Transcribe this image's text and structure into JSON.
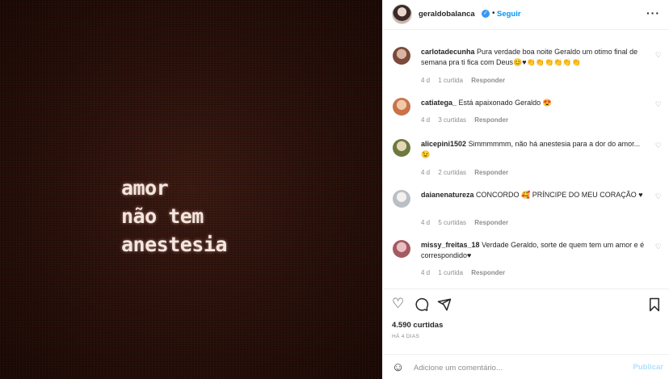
{
  "media": {
    "lines": [
      "amor",
      "não tem",
      "anestesia"
    ]
  },
  "header": {
    "username": "geraldobalanca",
    "separator": "•",
    "follow_label": "Seguir",
    "more_label": "···"
  },
  "comments": [
    {
      "username": "carlotadecunha",
      "text": "Pura verdade boa noite Geraldo um otimo final de semana pra ti fica com Deus😊♥👏👏👏👏👏👏",
      "age": "4 d",
      "likes": "1 curtida",
      "reply": "Responder",
      "avatar_color": "#7a4a3a"
    },
    {
      "username": "catiatega_",
      "text": "Está apaixonado Geraldo 😍",
      "age": "4 d",
      "likes": "3 curtidas",
      "reply": "Responder",
      "avatar_color": "#c9734a"
    },
    {
      "username": "alicepini1502",
      "text": "Simmmmmm, não há anestesia para a dor do amor...😉",
      "age": "4 d",
      "likes": "2 curtidas",
      "reply": "Responder",
      "avatar_color": "#6d7a3f"
    },
    {
      "username": "daianenatureza",
      "text": "CONCORDO 🥰 PRÍNCIPE DO MEU CORAÇÃO ♥",
      "age": "4 d",
      "likes": "5 curtidas",
      "reply": "Responder",
      "avatar_color": "#b9bfc6"
    },
    {
      "username": "missy_freitas_18",
      "text": "Verdade Geraldo, sorte de quem tem um amor e é correspondido♥",
      "age": "4 d",
      "likes": "1 curtida",
      "reply": "Responder",
      "avatar_color": "#a55a62"
    }
  ],
  "actions": {
    "like_count": "4.590 curtidas",
    "time_ago": "HÁ 4 DIAS"
  },
  "add_comment": {
    "placeholder": "Adicione um comentário...",
    "post_label": "Publicar"
  },
  "colors": {
    "accent": "#0095f6",
    "muted": "#8e8e8e",
    "border": "#efefef"
  }
}
